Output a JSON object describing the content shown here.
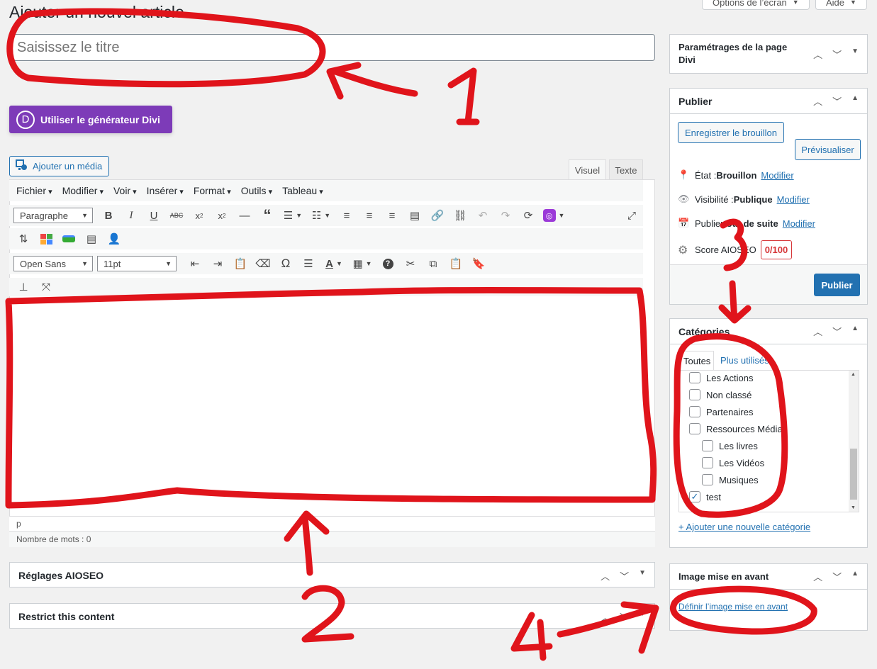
{
  "page": {
    "title": "Ajouter un nouvel article"
  },
  "top_buttons": {
    "screen_options": "Options de l’écran",
    "help": "Aide"
  },
  "title_field": {
    "placeholder": "Saisissez le titre",
    "value": ""
  },
  "divi": {
    "button_label": "Utiliser le générateur Divi",
    "logo_letter": "D"
  },
  "media": {
    "button_label": "Ajouter un média"
  },
  "editor_tabs": {
    "visual": "Visuel",
    "text": "Texte"
  },
  "menubar": {
    "items": [
      "Fichier",
      "Modifier",
      "Voir",
      "Insérer",
      "Format",
      "Outils",
      "Tableau"
    ]
  },
  "toolbar": {
    "paragraph": "Paragraphe",
    "font_family": "Open Sans",
    "font_size": "11pt"
  },
  "status": {
    "path": "p",
    "word_count": "Nombre de mots : 0"
  },
  "aioseo_box": {
    "title": "Réglages AIOSEO"
  },
  "restrict_box": {
    "title": "Restrict this content"
  },
  "divi_settings": {
    "title_line1": "Paramétrages de la page",
    "title_line2": "Divi"
  },
  "publish": {
    "title": "Publier",
    "save_draft": "Enregistrer le brouillon",
    "preview": "Prévisualiser",
    "status_label": "État : ",
    "status_value": "Brouillon",
    "visibility_label": "Visibilité : ",
    "visibility_value": "Publique",
    "publish_label": "Publier ",
    "publish_value": "tout de suite",
    "modify": "Modifier",
    "score_label": "Score AIOSEO",
    "score_value": "0/100",
    "publish_button": "Publier"
  },
  "categories": {
    "title": "Catégories",
    "tab_all": "Toutes",
    "tab_popular": "Plus utilisés",
    "items": [
      {
        "label": "Les Actions",
        "checked": false,
        "indent": false
      },
      {
        "label": "Non classé",
        "checked": false,
        "indent": false
      },
      {
        "label": "Partenaires",
        "checked": false,
        "indent": false
      },
      {
        "label": "Ressources Média",
        "checked": false,
        "indent": false
      },
      {
        "label": "Les livres",
        "checked": false,
        "indent": true
      },
      {
        "label": "Les Vidéos",
        "checked": false,
        "indent": true
      },
      {
        "label": "Musiques",
        "checked": false,
        "indent": true
      },
      {
        "label": "test",
        "checked": true,
        "indent": false
      }
    ],
    "add_new": "+ Ajouter une nouvelle catégorie"
  },
  "featured_image": {
    "title": "Image mise en avant",
    "set_link": "Définir l’image mise en avant"
  },
  "annotations": {
    "n1": "1",
    "n2": "2",
    "n3": "3",
    "n4": "4",
    "color": "#e0141b"
  }
}
